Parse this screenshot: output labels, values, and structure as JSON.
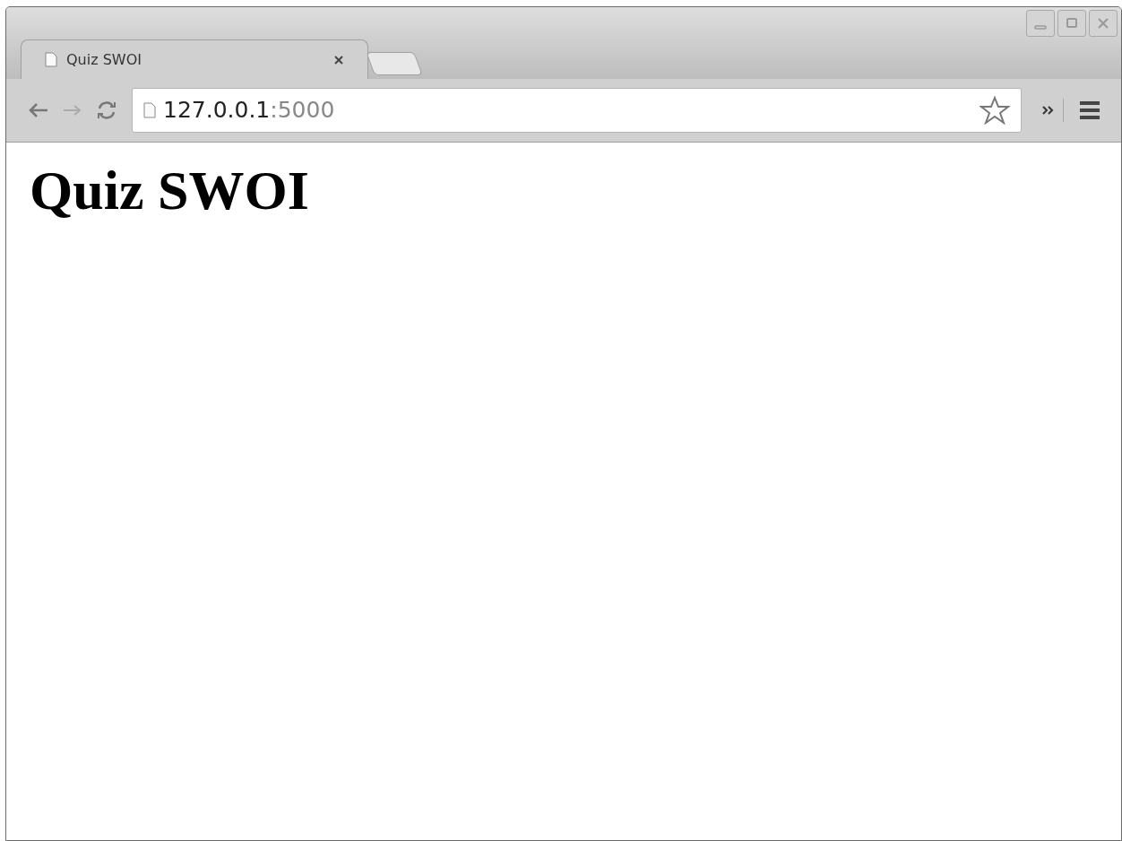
{
  "tabs": [
    {
      "title": "Quiz SWOI",
      "selected": true
    }
  ],
  "address_bar": {
    "host": "127.0.0.1",
    "port": ":5000"
  },
  "page": {
    "heading": "Quiz SWOI"
  }
}
